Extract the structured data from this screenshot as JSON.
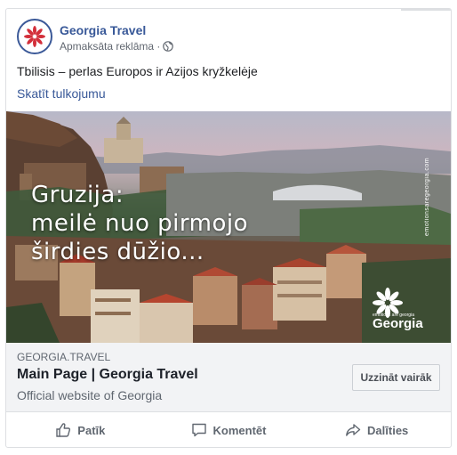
{
  "page": {
    "name": "Georgia Travel",
    "sponsored_label": "Apmaksāta reklāma · "
  },
  "post": {
    "text": "Tbilisis – perlas Europos ir Azijos kryžkelėje",
    "translate_link": "Skatīt tulkojumu"
  },
  "ad_image": {
    "headline_lines": [
      "Gruzija:",
      "meilė nuo pirmojo",
      "širdies dūžio..."
    ],
    "side_url": "emotionsaregeorgia.com",
    "brand_small": "emotions are georgia",
    "brand_name": "Georgia"
  },
  "link": {
    "domain": "GEORGIA.TRAVEL",
    "title": "Main Page | Georgia Travel",
    "description": "Official website of Georgia",
    "cta_label": "Uzzināt vairāk"
  },
  "actions": {
    "like": "Patīk",
    "comment": "Komentēt",
    "share": "Dalīties"
  },
  "colors": {
    "brand_blue": "#385898",
    "logo_red": "#d32f3a",
    "muted_text": "#606770"
  },
  "icons": {
    "avatar": "georgia-flower-logo-icon",
    "audience": "globe-icon",
    "like": "thumbs-up-icon",
    "comment": "comment-bubble-icon",
    "share": "share-arrow-icon"
  }
}
